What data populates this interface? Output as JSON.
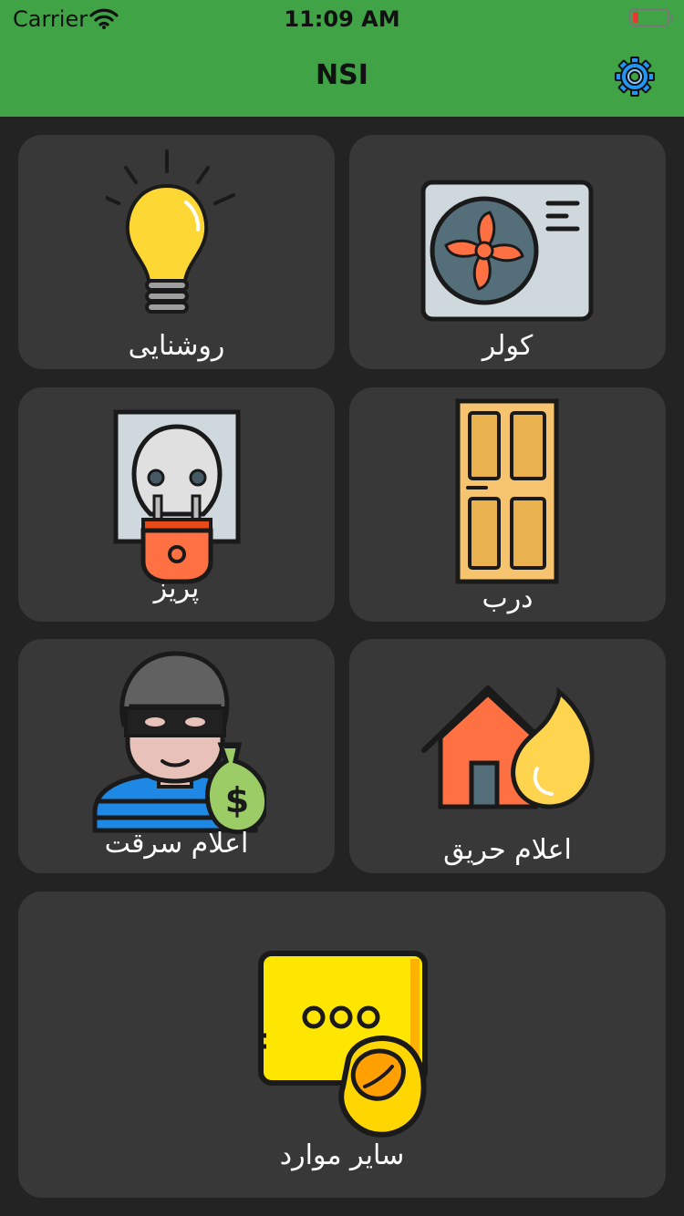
{
  "status_bar": {
    "carrier": "Carrier",
    "time": "11:09 AM"
  },
  "nav": {
    "title": "NSI",
    "settings_icon": "gear-icon"
  },
  "accent_color": "#40a346",
  "tiles": [
    {
      "label": "روشنایی",
      "icon": "light-bulb-icon"
    },
    {
      "label": "کولر",
      "icon": "air-conditioner-icon"
    },
    {
      "label": "پریز",
      "icon": "power-outlet-icon"
    },
    {
      "label": "درب",
      "icon": "door-icon"
    },
    {
      "label": "اعلام سرقت",
      "icon": "thief-icon"
    },
    {
      "label": "اعلام حریق",
      "icon": "house-fire-icon"
    },
    {
      "label": "سایر موارد",
      "icon": "push-button-icon"
    }
  ]
}
